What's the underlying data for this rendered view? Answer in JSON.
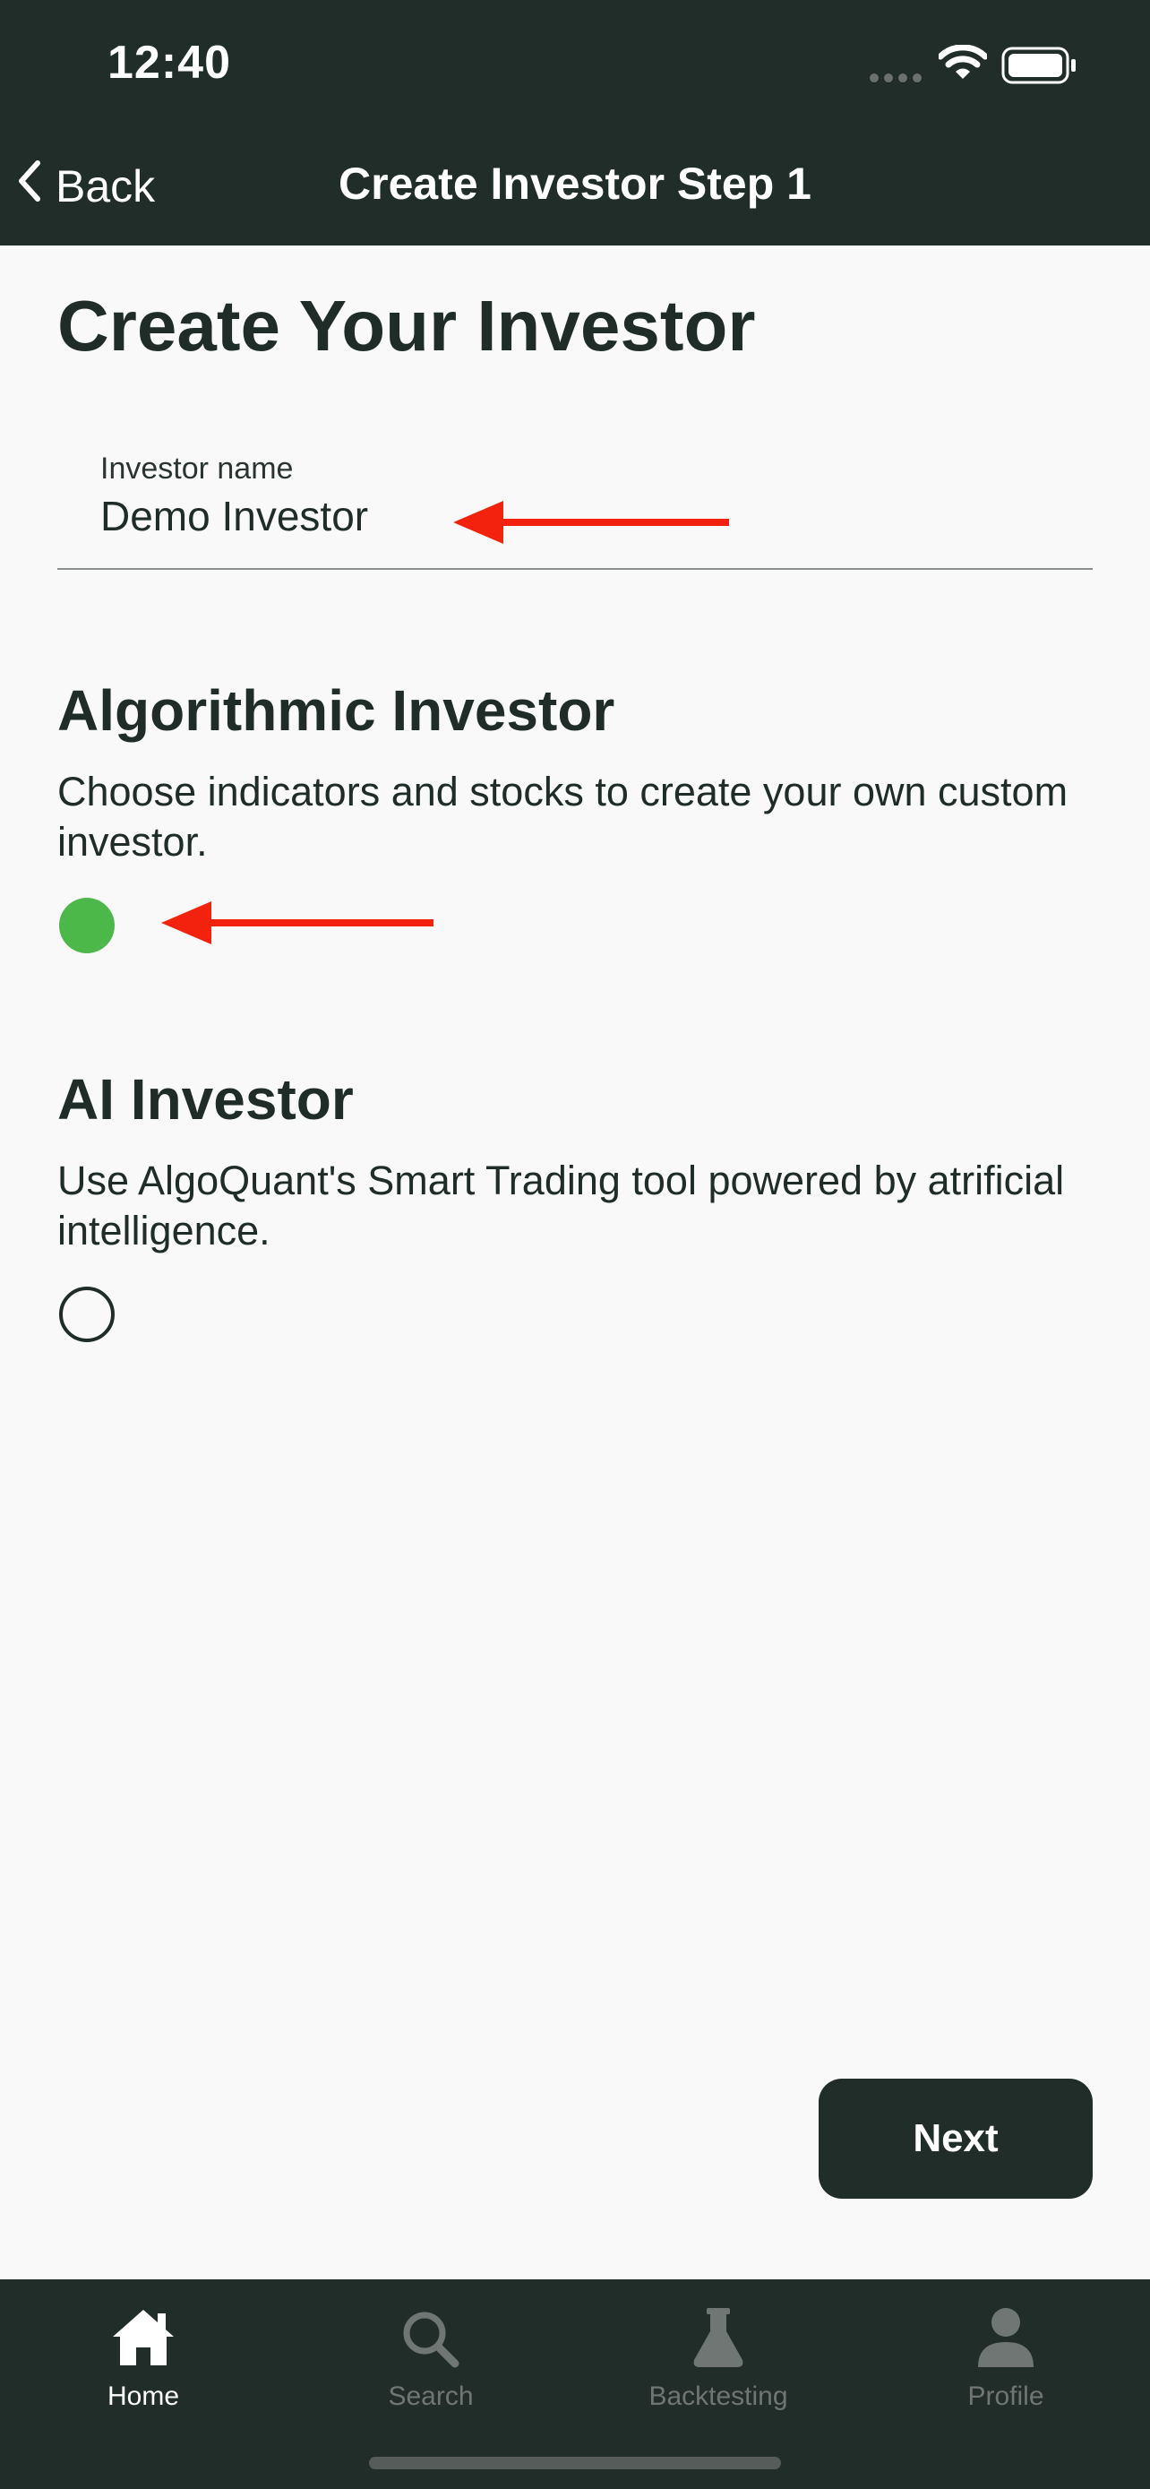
{
  "status_bar": {
    "time": "12:40",
    "icons": [
      "signal-icon",
      "wifi-icon",
      "battery-icon"
    ]
  },
  "nav": {
    "back_label": "Back",
    "title": "Create Investor Step 1"
  },
  "page": {
    "heading": "Create Your Investor"
  },
  "investor_name_field": {
    "label": "Investor name",
    "value": "Demo Investor"
  },
  "options": [
    {
      "title": "Algorithmic Investor",
      "description": "Choose indicators and stocks to create your own custom investor.",
      "selected": true
    },
    {
      "title": "AI Investor",
      "description": "Use AlgoQuant's Smart Trading tool powered by atrificial intelligence.",
      "selected": false
    }
  ],
  "next_button": {
    "label": "Next"
  },
  "tab_bar": {
    "tabs": [
      {
        "label": "Home",
        "icon": "home-icon",
        "active": true
      },
      {
        "label": "Search",
        "icon": "search-icon",
        "active": false
      },
      {
        "label": "Backtesting",
        "icon": "flask-icon",
        "active": false
      },
      {
        "label": "Profile",
        "icon": "person-icon",
        "active": false
      }
    ]
  },
  "colors": {
    "header_bg": "#202d29",
    "page_bg": "#f9f9f9",
    "selected_radio": "#4cb849",
    "annotation_arrow": "#f2220f"
  }
}
